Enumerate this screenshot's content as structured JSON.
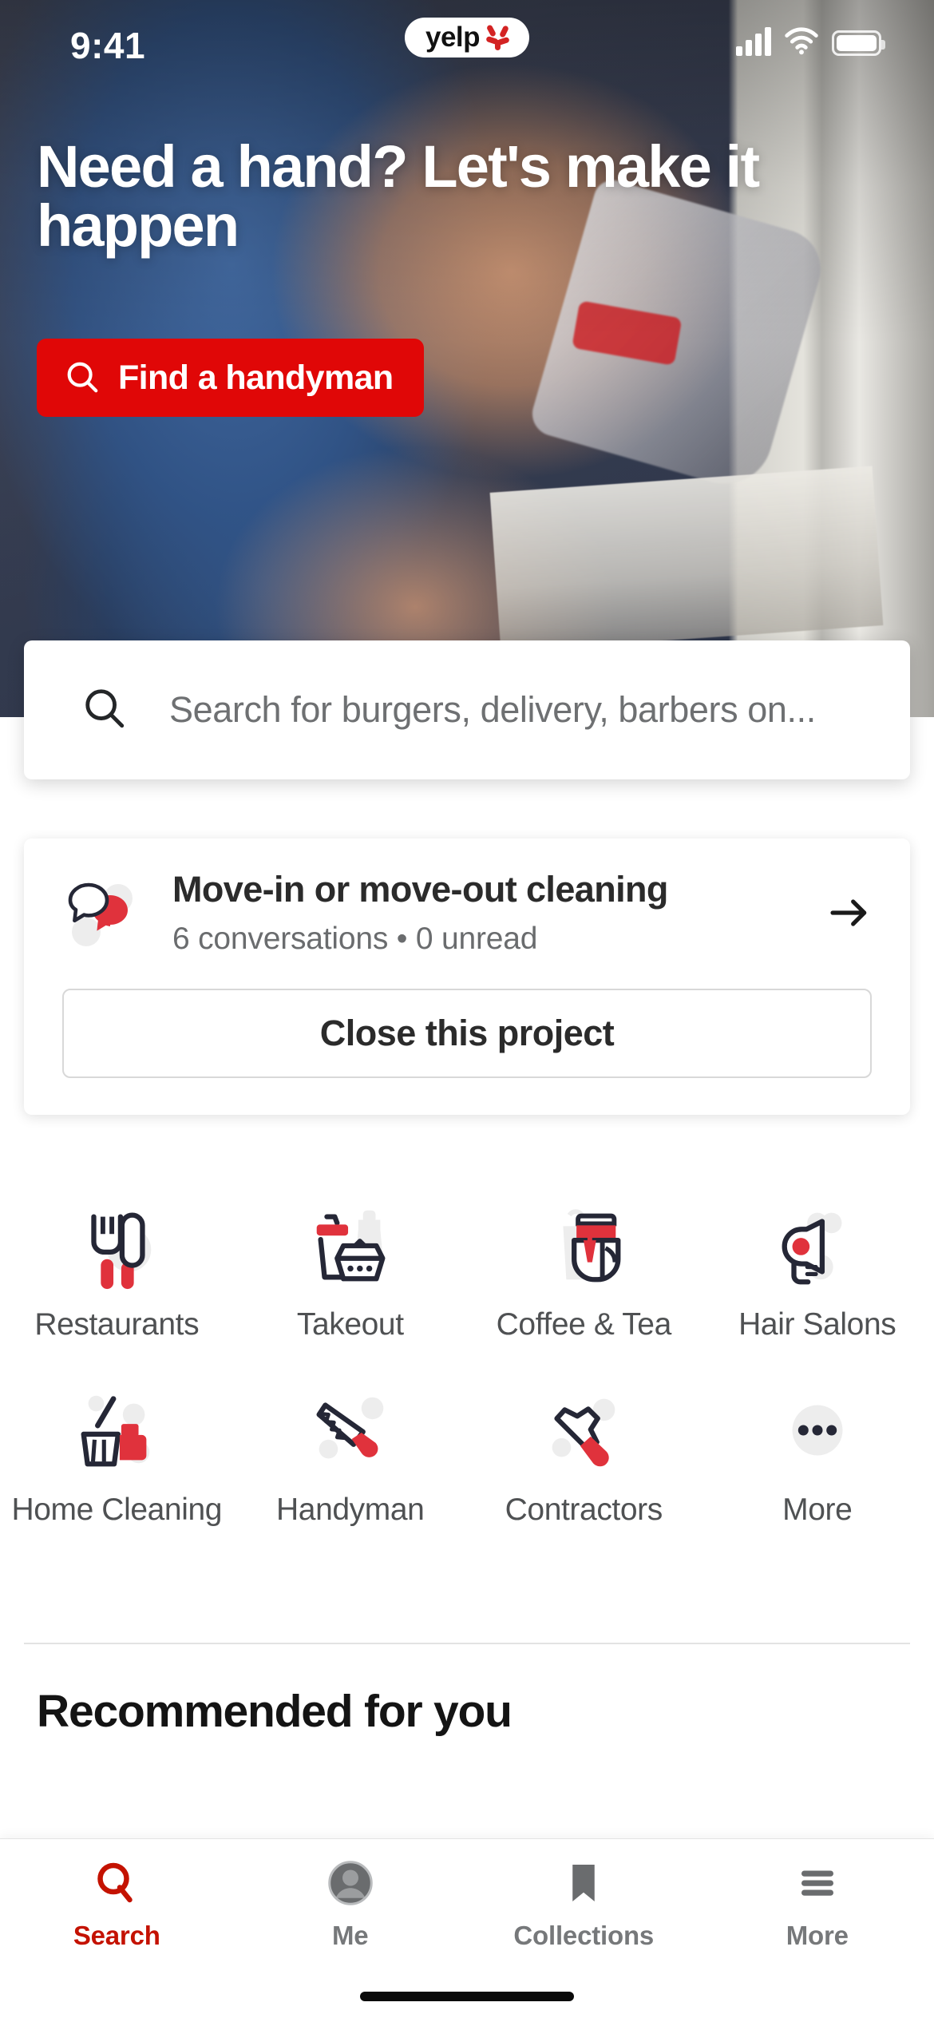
{
  "status_bar": {
    "time": "9:41",
    "app_pill_text": "yelp",
    "signal_icon": "cellular-signal-icon",
    "wifi_icon": "wifi-icon",
    "battery_icon": "battery-icon"
  },
  "hero": {
    "title": "Need a hand? Let's make it happen",
    "cta_label": "Find a handyman",
    "cta_icon": "search-icon",
    "cta_color": "#e00707"
  },
  "search": {
    "placeholder": "Search for burgers, delivery, barbers on...",
    "icon": "search-icon"
  },
  "project_card": {
    "icon": "chat-bubbles-icon",
    "title": "Move-in or move-out cleaning",
    "subtitle": "6 conversations • 0 unread",
    "arrow_icon": "arrow-right-icon",
    "close_button_label": "Close this project"
  },
  "categories": [
    {
      "label": "Restaurants",
      "icon": "fork-and-knife-icon"
    },
    {
      "label": "Takeout",
      "icon": "takeout-box-icon"
    },
    {
      "label": "Coffee & Tea",
      "icon": "coffee-cup-icon"
    },
    {
      "label": "Hair Salons",
      "icon": "hair-dryer-icon"
    },
    {
      "label": "Home Cleaning",
      "icon": "broom-icon"
    },
    {
      "label": "Handyman",
      "icon": "saw-icon"
    },
    {
      "label": "Contractors",
      "icon": "hammer-icon"
    },
    {
      "label": "More",
      "icon": "ellipsis-icon"
    }
  ],
  "recommended": {
    "heading": "Recommended for you"
  },
  "tabbar": {
    "items": [
      {
        "label": "Search",
        "icon": "search-icon",
        "active": true
      },
      {
        "label": "Me",
        "icon": "avatar-icon",
        "active": false
      },
      {
        "label": "Collections",
        "icon": "bookmark-icon",
        "active": false
      },
      {
        "label": "More",
        "icon": "hamburger-menu-icon",
        "active": false
      }
    ],
    "active_color": "#c41200",
    "inactive_color": "#76787a"
  },
  "colors": {
    "brand_red": "#d32323",
    "cta_red": "#e00707",
    "icon_dark": "#252736",
    "icon_red": "#e0323c",
    "icon_ghost": "#ededed"
  }
}
